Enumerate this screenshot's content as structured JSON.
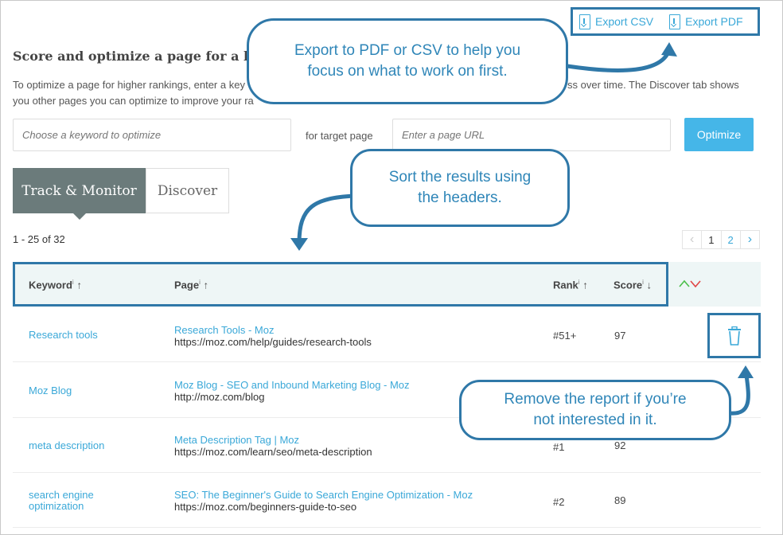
{
  "export": {
    "csv_label": "Export CSV",
    "pdf_label": "Export PDF"
  },
  "header": {
    "title": "Score and optimize a page for a key",
    "description_line1": "To optimize a page for higher rankings, enter a key",
    "description_line1_end": "ss over time. The Discover tab shows",
    "description_line2": "you other pages you can optimize to improve your ra"
  },
  "form": {
    "keyword_placeholder": "Choose a keyword to optimize",
    "target_label": "for target page",
    "url_placeholder": "Enter a page URL",
    "optimize_label": "Optimize"
  },
  "tabs": [
    {
      "label": "Track & Monitor",
      "active": true
    },
    {
      "label": "Discover",
      "active": false
    }
  ],
  "results_count": "1 - 25 of 32",
  "pagination": {
    "prev": "‹",
    "current": "1",
    "next_page": "2",
    "next": "›"
  },
  "table": {
    "headers": {
      "keyword": "Keyword",
      "page": "Page",
      "rank": "Rank",
      "score": "Score",
      "info_mark": "i",
      "sort_up": "↑",
      "sort_down": "↓"
    },
    "rows": [
      {
        "keyword": "Research tools",
        "page_title": "Research Tools - Moz",
        "page_url": "https://moz.com/help/guides/research-tools",
        "rank": "#51+",
        "score": "97"
      },
      {
        "keyword": "Moz Blog",
        "page_title": "Moz Blog - SEO and Inbound Marketing Blog - Moz",
        "page_url": "http://moz.com/blog",
        "rank": "",
        "score": ""
      },
      {
        "keyword": "meta description",
        "page_title": "Meta Description Tag | Moz",
        "page_url": "https://moz.com/learn/seo/meta-description",
        "rank": "#1",
        "score": "92"
      },
      {
        "keyword": "search engine optimization",
        "page_title": "SEO: The Beginner's Guide to Search Engine Optimization - Moz",
        "page_url": "https://moz.com/beginners-guide-to-seo",
        "rank": "#2",
        "score": "89"
      }
    ]
  },
  "callouts": {
    "export_line1": "Export to PDF or CSV to help you",
    "export_line2": "focus on what to work on first.",
    "sort_line1": "Sort the results using",
    "sort_line2": "the headers.",
    "remove_line1": "Remove the report if you’re",
    "remove_line2": "not interested in it."
  },
  "colors": {
    "accent": "#3aa8d8",
    "callout_border": "#2f78a8",
    "tab_active": "#6b7b7b",
    "button": "#45b6e8"
  }
}
